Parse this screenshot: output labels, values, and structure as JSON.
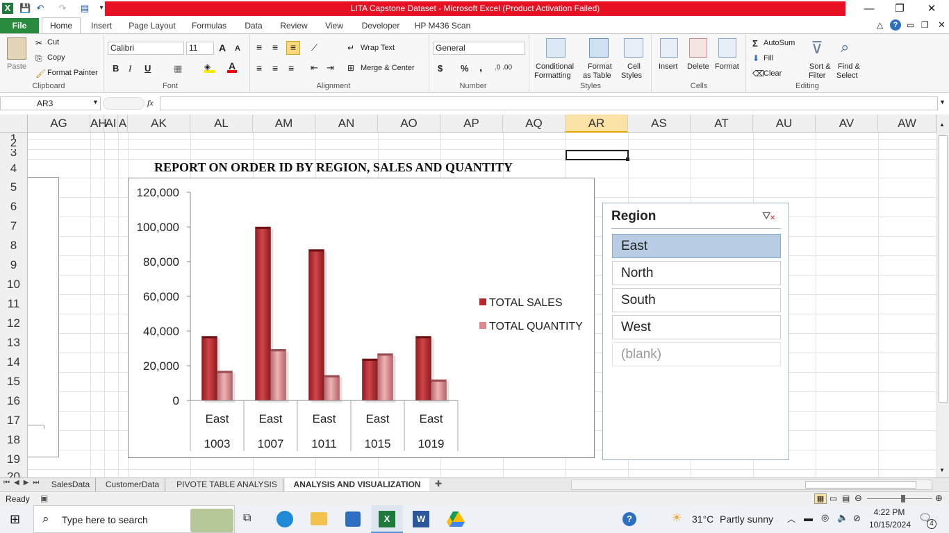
{
  "window": {
    "title": "LITA Capstone Dataset  -  Microsoft Excel (Product Activation Failed)",
    "minimize_glyph": "—",
    "restore_glyph": "❐",
    "close_glyph": "✕"
  },
  "ribbon_tabs": [
    "File",
    "Home",
    "Insert",
    "Page Layout",
    "Formulas",
    "Data",
    "Review",
    "View",
    "Developer",
    "HP M436 Scan"
  ],
  "clipboard": {
    "paste": "Paste",
    "cut": "Cut",
    "copy": "Copy",
    "format_painter": "Format Painter",
    "label": "Clipboard"
  },
  "font": {
    "name": "Calibri",
    "size": "11",
    "bold": "B",
    "italic": "I",
    "underline": "U",
    "grow": "A",
    "shrink": "A",
    "label": "Font"
  },
  "alignment": {
    "wrap_text": "Wrap Text",
    "merge_center": "Merge & Center",
    "label": "Alignment"
  },
  "number": {
    "format": "General",
    "currency": "$",
    "percent": "%",
    "comma": ",",
    "inc_dec": ".0 .00",
    "label": "Number"
  },
  "styles": {
    "conditional": "Conditional",
    "conditional2": "Formatting",
    "format_as": "Format",
    "format_as2": "as Table",
    "cell": "Cell",
    "cell2": "Styles",
    "label": "Styles"
  },
  "cells": {
    "insert": "Insert",
    "delete": "Delete",
    "format": "Format",
    "label": "Cells"
  },
  "editing": {
    "autosum": "AutoSum",
    "fill": "Fill",
    "clear": "Clear",
    "sort": "Sort &",
    "sort2": "Filter",
    "find": "Find &",
    "find2": "Select",
    "label": "Editing"
  },
  "formula_bar": {
    "name_box": "AR3",
    "fx": "fx",
    "formula": ""
  },
  "columns": [
    "AG",
    "AH",
    "AI",
    "A",
    "AK",
    "AL",
    "AM",
    "AN",
    "AO",
    "AP",
    "AQ",
    "AR",
    "AS",
    "AT",
    "AU",
    "AV",
    "AW"
  ],
  "rows": [
    "1",
    "2",
    "3",
    "4",
    "5",
    "6",
    "7",
    "8",
    "9",
    "10",
    "11",
    "12",
    "13",
    "14",
    "15",
    "16",
    "17",
    "18",
    "19",
    "20"
  ],
  "report_title": "REPORT ON ORDER ID BY REGION, SALES AND QUANTITY",
  "chart_data": {
    "type": "bar",
    "title": "",
    "categories": [
      "East 1003",
      "East 1007",
      "East 1011",
      "East 1015",
      "East 1019"
    ],
    "category_top": [
      "East",
      "East",
      "East",
      "East",
      "East"
    ],
    "category_bottom": [
      "1003",
      "1007",
      "1011",
      "1015",
      "1019"
    ],
    "series": [
      {
        "name": "TOTAL SALES",
        "values": [
          37000,
          100000,
          87000,
          24000,
          37000
        ],
        "color": "#b42a2f"
      },
      {
        "name": "TOTAL QUANTITY",
        "values": [
          17000,
          29500,
          14500,
          27000,
          12000
        ],
        "color": "#d98b8d"
      }
    ],
    "yticks": [
      "0",
      "20,000",
      "40,000",
      "60,000",
      "80,000",
      "100,000",
      "120,000"
    ],
    "ylim": [
      0,
      120000
    ],
    "legend_position": "right",
    "grid": false
  },
  "slicer": {
    "title": "Region",
    "items": [
      "East",
      "North",
      "South",
      "West",
      "(blank)"
    ],
    "selected": "East"
  },
  "sheet_tabs": [
    "SalesData",
    "CustomerData",
    "PIVOTE TABLE ANALYSIS",
    "ANALYSIS AND VISUALIZATION"
  ],
  "active_sheet": "ANALYSIS AND VISUALIZATION",
  "status": {
    "text": "Ready"
  },
  "taskbar": {
    "search_placeholder": "Type here to search",
    "weather_temp": "31°C",
    "weather_text": "Partly sunny",
    "time": "4:22 PM",
    "date": "10/15/2024",
    "notifications": "4"
  }
}
